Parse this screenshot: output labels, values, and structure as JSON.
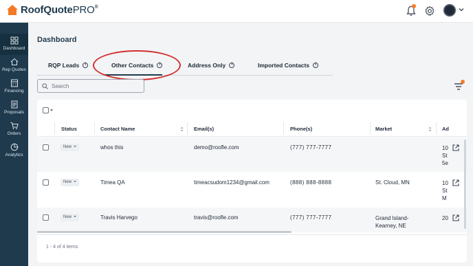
{
  "app": {
    "brand_main": "RoofQuote",
    "brand_pro": "PRO",
    "brand_mark": "®"
  },
  "colors": {
    "brand_orange": "#f47a2a",
    "sidebar_bg": "#1f3a4d",
    "highlight": "#d32f2f"
  },
  "header": {
    "notification_icon": "bell-icon",
    "settings_icon": "gear-icon",
    "account_icon": "avatar"
  },
  "sidebar": {
    "items": [
      {
        "label": "Dashboard",
        "icon": "dashboard-icon",
        "active": true
      },
      {
        "label": "Rep Quotes",
        "icon": "house-icon"
      },
      {
        "label": "Financing",
        "icon": "calculator-icon"
      },
      {
        "label": "Proposals",
        "icon": "document-icon"
      },
      {
        "label": "Orders",
        "icon": "cart-icon"
      },
      {
        "label": "Analytics",
        "icon": "pie-chart-icon"
      }
    ]
  },
  "page": {
    "title": "Dashboard"
  },
  "tabs": [
    {
      "label": "RQP Leads"
    },
    {
      "label": "Other Contacts",
      "active": true
    },
    {
      "label": "Address Only"
    },
    {
      "label": "Imported Contacts"
    }
  ],
  "search": {
    "placeholder": "Search"
  },
  "table": {
    "columns": [
      "Status",
      "Contact Name",
      "Email(s)",
      "Phone(s)",
      "Market",
      "Ad"
    ],
    "rows": [
      {
        "status": "New",
        "name": "whos this",
        "email": "demo@roofle.com",
        "phone": "(777) 777-7777",
        "market": "",
        "address": "10 St 5e"
      },
      {
        "status": "New",
        "name": "Timea QA",
        "email": "timeacsudom1234@gmail.com",
        "phone": "(888) 888-8888",
        "market": "St. Cloud, MN",
        "address": "10 St M"
      },
      {
        "status": "New",
        "name": "Travis Harvego",
        "email": "travis@roofle.com",
        "phone": "(777) 777-7777",
        "market": "Grand Island-Kearney, NE",
        "address": "20"
      }
    ],
    "pagination": "1 - 4 of 4 items"
  }
}
